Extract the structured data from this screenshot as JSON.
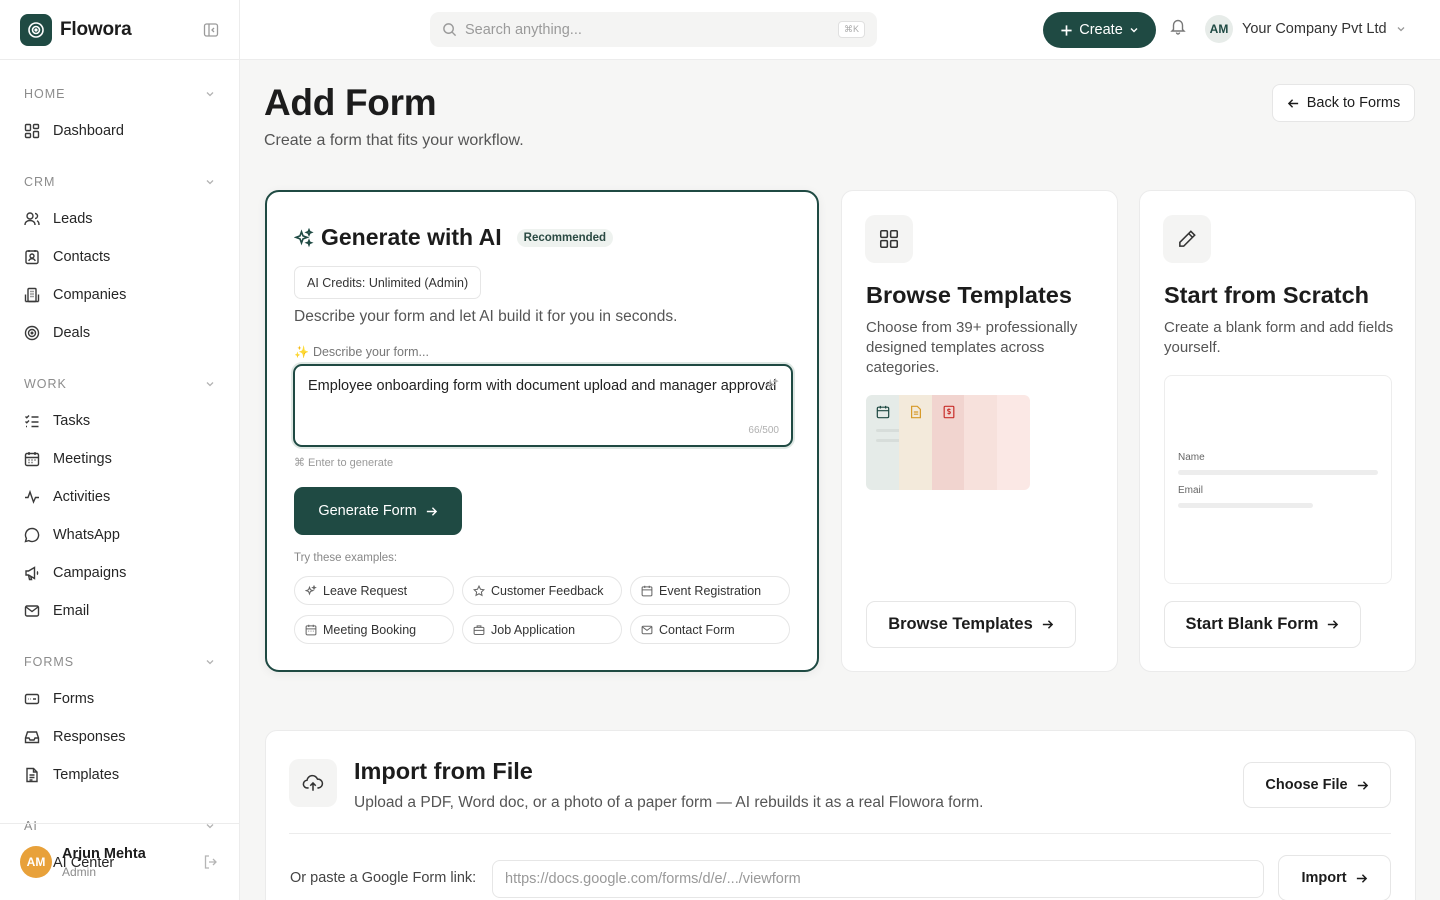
{
  "app": {
    "name": "Flowora"
  },
  "sidebar": {
    "sections": [
      {
        "label": "HOME",
        "items": [
          {
            "label": "Dashboard",
            "icon": "dashboard-icon"
          }
        ]
      },
      {
        "label": "CRM",
        "items": [
          {
            "label": "Leads",
            "icon": "leads-icon"
          },
          {
            "label": "Contacts",
            "icon": "contacts-icon"
          },
          {
            "label": "Companies",
            "icon": "building-icon"
          },
          {
            "label": "Deals",
            "icon": "target-icon"
          }
        ]
      },
      {
        "label": "WORK",
        "items": [
          {
            "label": "Tasks",
            "icon": "tasks-icon"
          },
          {
            "label": "Meetings",
            "icon": "calendar-icon"
          },
          {
            "label": "Activities",
            "icon": "activity-icon"
          },
          {
            "label": "WhatsApp",
            "icon": "chat-icon"
          },
          {
            "label": "Campaigns",
            "icon": "megaphone-icon"
          },
          {
            "label": "Email",
            "icon": "mail-icon"
          }
        ]
      },
      {
        "label": "FORMS",
        "items": [
          {
            "label": "Forms",
            "icon": "form-icon"
          },
          {
            "label": "Responses",
            "icon": "inbox-icon"
          },
          {
            "label": "Templates",
            "icon": "document-icon"
          }
        ]
      },
      {
        "label": "AI",
        "items": [
          {
            "label": "AI Center",
            "icon": "sparkle-icon"
          }
        ]
      }
    ],
    "user": {
      "initials": "AM",
      "name": "Arjun Mehta",
      "role": "Admin"
    }
  },
  "topbar": {
    "search_placeholder": "Search anything...",
    "search_shortcut": "⌘K",
    "create_label": "Create",
    "company_initials": "AM",
    "company_name": "Your Company Pvt Ltd"
  },
  "page": {
    "title": "Add Form",
    "subtitle": "Create a form that fits your workflow.",
    "back_label": "Back to Forms"
  },
  "ai_card": {
    "title": "Generate with AI",
    "badge": "Recommended",
    "credits": "AI Credits: Unlimited (Admin)",
    "description": "Describe your form and let AI build it for you in seconds.",
    "prompt_label": "Describe your form...",
    "prompt_value": "Employee onboarding form with document upload and manager approval",
    "char_count": "66/500",
    "hint": "⌘ Enter to generate",
    "generate_label": "Generate Form",
    "examples_label": "Try these examples:",
    "examples": [
      {
        "label": "Leave Request",
        "icon": "sparkle-icon"
      },
      {
        "label": "Customer Feedback",
        "icon": "star-icon"
      },
      {
        "label": "Event Registration",
        "icon": "calendar-icon"
      },
      {
        "label": "Meeting Booking",
        "icon": "calendar-icon"
      },
      {
        "label": "Job Application",
        "icon": "briefcase-icon"
      },
      {
        "label": "Contact Form",
        "icon": "mail-icon"
      }
    ]
  },
  "templates_card": {
    "title": "Browse Templates",
    "description": "Choose from 39+ professionally designed templates across categories.",
    "button": "Browse Templates"
  },
  "scratch_card": {
    "title": "Start from Scratch",
    "description": "Create a blank form and add fields yourself.",
    "preview_field1": "Name",
    "preview_field2": "Email",
    "button": "Start Blank Form"
  },
  "import_card": {
    "title": "Import from File",
    "description": "Upload a PDF, Word doc, or a photo of a paper form — AI rebuilds it as a real Flowora form.",
    "choose_label": "Choose File",
    "google_label": "Or paste a Google Form link:",
    "google_placeholder": "https://docs.google.com/forms/d/e/.../viewform",
    "import_label": "Import"
  },
  "colors": {
    "brand": "#1f4a43",
    "accent_avatar": "#e8a13a"
  }
}
